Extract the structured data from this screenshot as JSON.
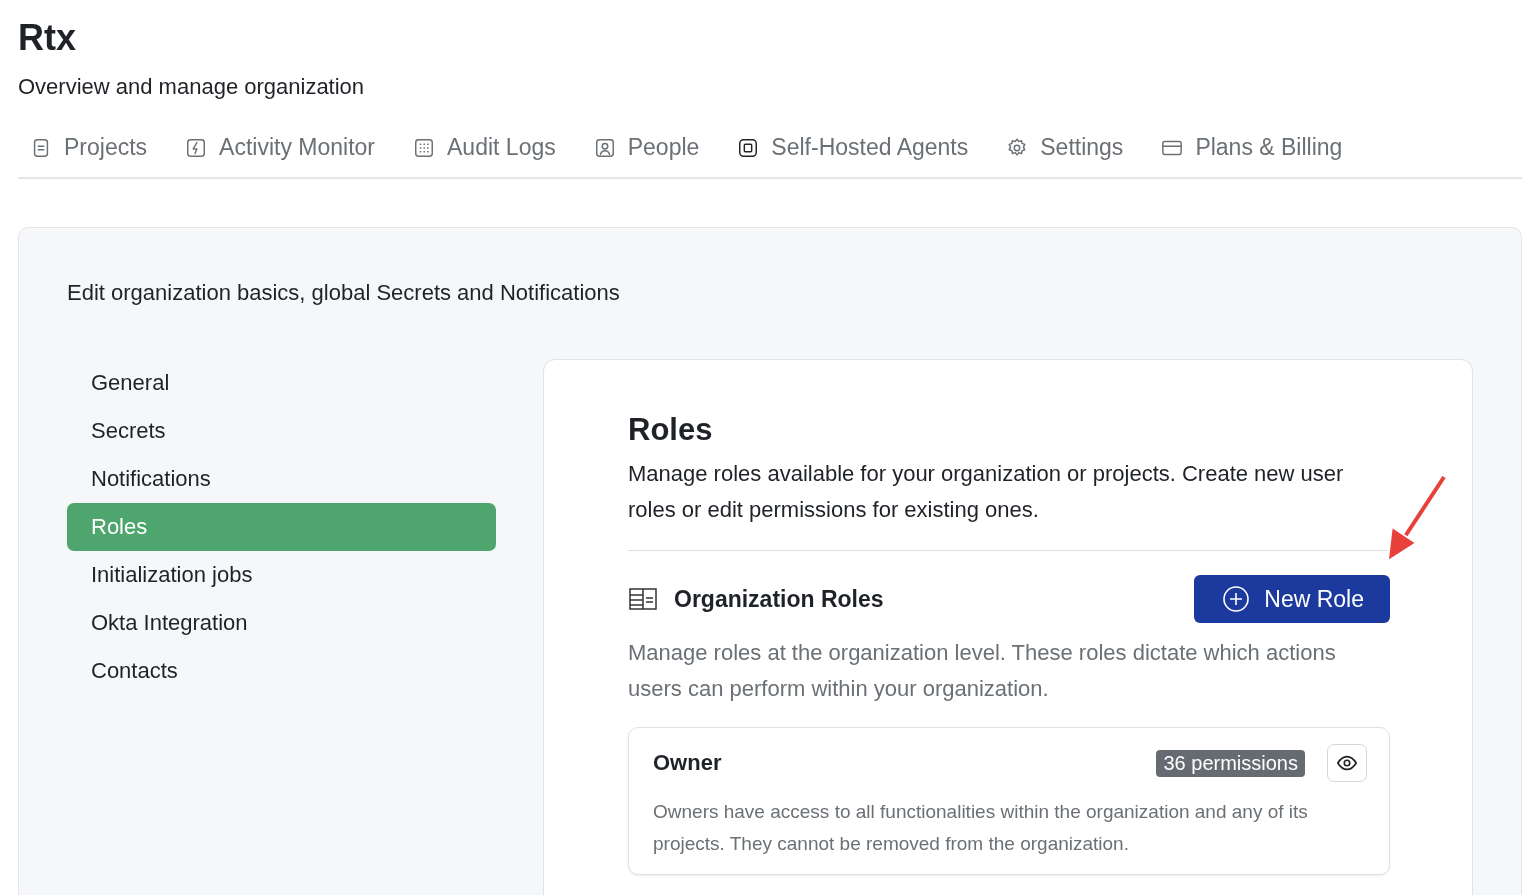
{
  "header": {
    "title": "Rtx",
    "subtitle": "Overview and manage organization"
  },
  "tabs": [
    {
      "label": "Projects",
      "kind": "doc"
    },
    {
      "label": "Activity Monitor",
      "kind": "bolt"
    },
    {
      "label": "Audit Logs",
      "kind": "grid"
    },
    {
      "label": "People",
      "kind": "person"
    },
    {
      "label": "Self-Hosted Agents",
      "kind": "chip"
    },
    {
      "label": "Settings",
      "kind": "gear"
    },
    {
      "label": "Plans & Billing",
      "kind": "card"
    }
  ],
  "settings": {
    "intro": "Edit organization basics, global Secrets and Notifications",
    "sidebar": {
      "items": [
        {
          "label": "General",
          "selected": false
        },
        {
          "label": "Secrets",
          "selected": false
        },
        {
          "label": "Notifications",
          "selected": false
        },
        {
          "label": "Roles",
          "selected": true
        },
        {
          "label": "Initialization jobs",
          "selected": false
        },
        {
          "label": "Okta Integration",
          "selected": false
        },
        {
          "label": "Contacts",
          "selected": false
        }
      ]
    },
    "roles": {
      "title": "Roles",
      "description": "Manage roles available for your organization or projects. Create new user roles or edit permissions for existing ones.",
      "section": {
        "title": "Organization Roles",
        "button": "New Role",
        "description": "Manage roles at the organization level. These roles dictate which actions users can perform within your organization.",
        "roles": [
          {
            "name": "Owner",
            "permissions": "36 permissions",
            "description": "Owners have access to all functionalities within the organization and any of its projects. They cannot be removed from the organization."
          }
        ]
      }
    }
  }
}
